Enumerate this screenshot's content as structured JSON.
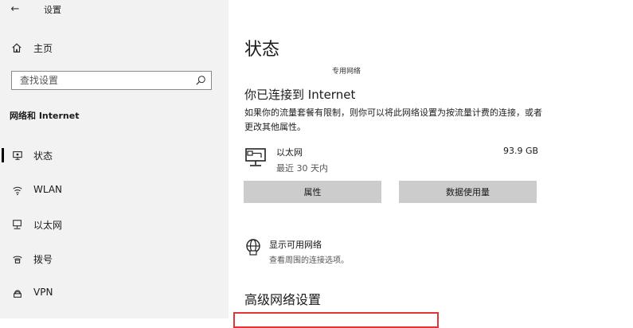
{
  "window": {
    "title": "设置",
    "back_glyph": "←"
  },
  "sidebar": {
    "home_label": "主页",
    "search_placeholder": "查找设置",
    "section_title": "网络和 Internet",
    "items": [
      {
        "label": "状态",
        "icon": "status-icon",
        "selected": true
      },
      {
        "label": "WLAN",
        "icon": "wifi-icon",
        "selected": false
      },
      {
        "label": "以太网",
        "icon": "ethernet-icon",
        "selected": false
      },
      {
        "label": "拨号",
        "icon": "dialup-icon",
        "selected": false
      },
      {
        "label": "VPN",
        "icon": "vpn-icon",
        "selected": false
      }
    ]
  },
  "main": {
    "page_title": "状态",
    "network_caption": "专用网络",
    "status_heading": "你已连接到 Internet",
    "status_desc": "如果你的流量套餐有限制，则你可以将此网络设置为按流量计费的连接，或者更改其他属性。",
    "ethernet": {
      "name": "以太网",
      "subtitle": "最近 30 天内",
      "usage": "93.9 GB",
      "icon": "ethernet-monitor-icon"
    },
    "buttons": {
      "properties": "属性",
      "data_usage": "数据使用量"
    },
    "available": {
      "label": "显示可用网络",
      "subtitle": "查看周围的连接选项。",
      "icon": "globe-icon"
    },
    "advanced_heading": "高级网络设置"
  },
  "colors": {
    "sidebar_bg": "#f2f2f2",
    "button_bg": "#cccccc",
    "highlight_border": "#e23535"
  }
}
